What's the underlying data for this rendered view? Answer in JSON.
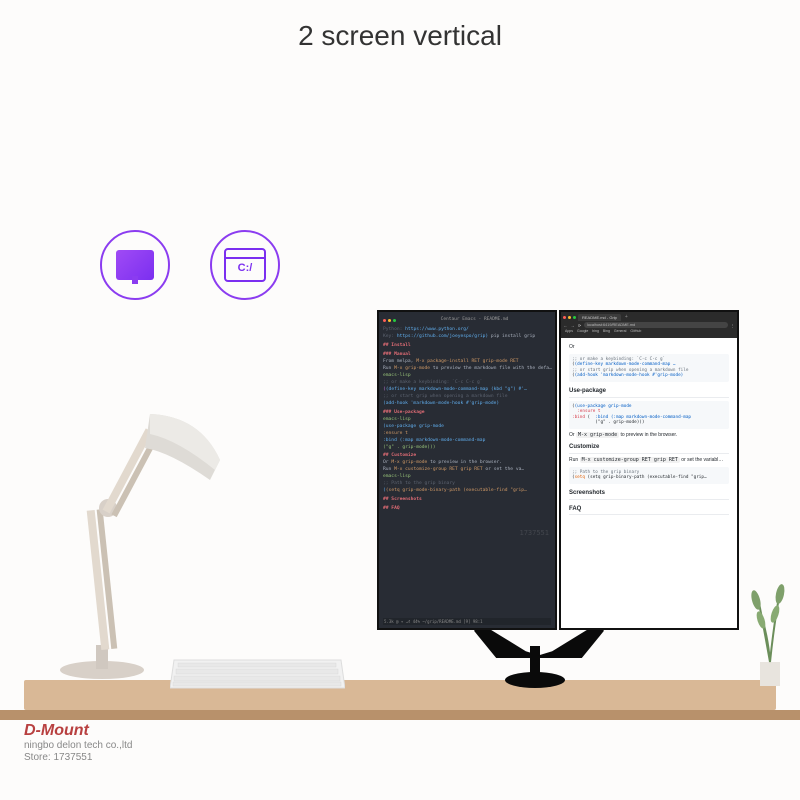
{
  "title": "2 screen vertical",
  "badges": {
    "window_label": "C:/"
  },
  "monitor1": {
    "tab_title": "Centaur Emacs - README.md",
    "lines": {
      "l1_a": "Python:",
      "l1_b": "https://www.python.org/",
      "l2_a": "Key:",
      "l2_b": "https://github.com/joeyespo/grip)",
      "l2_c": "pip install grip",
      "h_install": "## Install",
      "h_manual": "### Manual",
      "l3": "From melpa,",
      "l3b": "M-x package-install RET grip-mode RET",
      "l4": "Run",
      "l4b": "M-x grip-mode",
      "l4c": "to preview the markdown file with the defa…",
      "h_emacslisp": "emacs-lisp",
      "l5": ";; or make a keybinding: `C-c C-c g`",
      "l6": "(define-key markdown-mode-command-map (kbd \"g\") #'…",
      "l7": ";; or start grip when opening a markdown file",
      "l8": "(add-hook 'markdown-mode-hook #'grip-mode)",
      "h_usepackage": "### Use-package",
      "h_emacslisp2": "emacs-lisp",
      "l9": "(use-package grip-mode",
      "l10": "  :ensure t",
      "l11": "  :bind (:map markdown-mode-command-map",
      "l12": "         (\"g\" . grip-mode)))",
      "h_customize": "## Customize",
      "l13": "Or",
      "l13b": "M-x grip-mode",
      "l13c": "to preview in the browser.",
      "l14": "Run",
      "l14b": "M-x customize-group RET grip RET",
      "l14c": "or set the va…",
      "h_emacslisp3": "emacs-lisp",
      "l15": ";; Path to the grip binary",
      "l16": "(setq grip-mode-binary-path (executable-find \"grip…",
      "h_screenshots": "## Screenshots",
      "h_faq": "## FAQ",
      "statusbar": "5.3k  @ ▾  ⎇ 44% ~/grip/README.md  [9] 98:1"
    },
    "watermark": "1737551"
  },
  "monitor2": {
    "tab_label": "README.md - Grip",
    "url": "localhost:6419/README.md",
    "bookmarks": [
      "Apps",
      "Google",
      "bing",
      "Bing",
      "General",
      "GitHub"
    ],
    "body": {
      "t_or": "Or",
      "code1_comment": ";; or make a keybinding: `C-c C-c g`",
      "code1_line": "(define-key markdown-mode-command-map …",
      "code1_comment2": ";; or start grip when opening a markdown file",
      "code1_line2": "(add-hook 'markdown-mode-hook #'grip-mode)",
      "h_usepackage": "Use-package",
      "code2_l1": "(use-package grip-mode",
      "code2_l2": "  :ensure t",
      "code2_l3": "  :bind (:map markdown-mode-command-map",
      "code2_l4": "         (\"g\" . grip-mode)))",
      "p_or": "Or",
      "p_or_code": "M-x grip-mode",
      "p_or_tail": "to preview in the browser.",
      "h_customize": "Customize",
      "p_run": "Run",
      "p_run_code": "M-x customize-group RET grip RET",
      "p_run_tail": "or set the variabl…",
      "code3_comment": ";; Path to the grip binary",
      "code3_line": "(setq grip-binary-path (executable-find \"grip…",
      "h_screenshots": "Screenshots",
      "h_faq": "FAQ"
    }
  },
  "brand": {
    "main": "D-Mount",
    "sub1": "ningbo delon tech co.,ltd",
    "sub2": "Store: 1737551"
  }
}
